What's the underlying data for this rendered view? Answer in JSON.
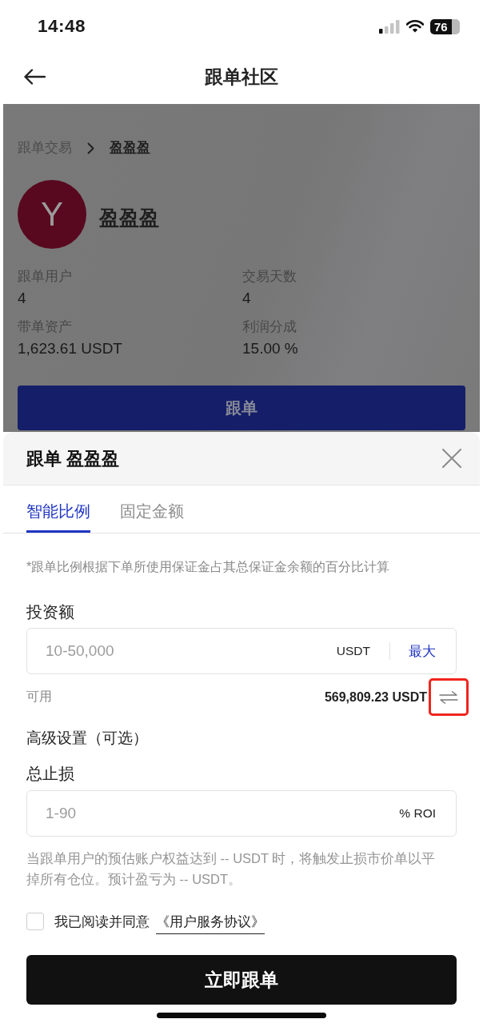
{
  "status_bar": {
    "time": "14:48",
    "battery": "76"
  },
  "header": {
    "title": "跟单社区"
  },
  "backdrop": {
    "breadcrumb": [
      {
        "label": "跟单交易",
        "current": false
      },
      {
        "label": "盈盈盈",
        "current": true
      }
    ],
    "trader": {
      "initial": "Y",
      "name": "盈盈盈"
    },
    "stats": [
      {
        "label": "跟单用户",
        "value": "4"
      },
      {
        "label": "交易天数",
        "value": "4"
      },
      {
        "label": "带单资产",
        "value": "1,623.61 USDT"
      },
      {
        "label": "利润分成",
        "value": "15.00 %"
      }
    ],
    "button": "跟单"
  },
  "sheet": {
    "title": "跟单 盈盈盈",
    "tabs": [
      {
        "label": "智能比例",
        "selected": true
      },
      {
        "label": "固定金额",
        "selected": false
      }
    ],
    "note": "*跟单比例根据下单所使用保证金占其总保证金余额的百分比计算",
    "investment": {
      "label": "投资额",
      "placeholder": "10-50,000",
      "unit": "USDT",
      "max_button": "最大"
    },
    "available": {
      "label": "可用",
      "value": "569,809.23 USDT",
      "highlighted": true
    },
    "advanced_title": "高级设置（可选）",
    "stop_loss": {
      "label": "总止损",
      "placeholder": "1-90",
      "unit": "% ROI"
    },
    "stop_loss_note": "当跟单用户的预估账户权益达到 -- USDT 时，将触发止损市价单以平掉所有仓位。预计盈亏为 -- USDT。",
    "agreement": {
      "checked": false,
      "text": "我已阅读并同意",
      "link": "《用户服务协议》"
    },
    "submit": "立即跟单"
  }
}
